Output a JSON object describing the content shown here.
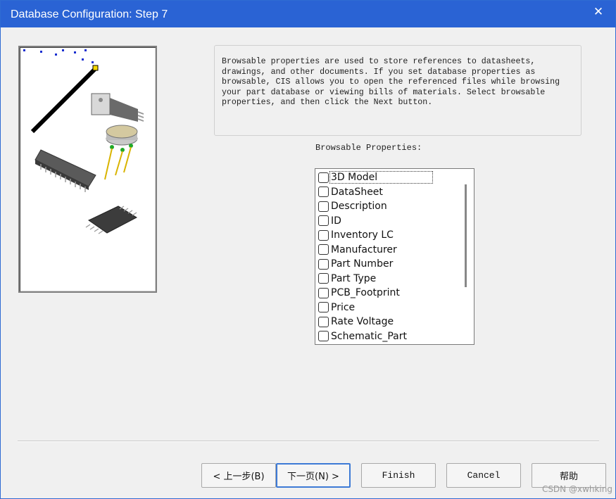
{
  "window": {
    "title": "Database Configuration: Step 7",
    "close_symbol": "✕"
  },
  "description": "Browsable properties are used to store references to datasheets, drawings, and other documents. If you set database properties as browsable, CIS allows you to open the referenced files while browsing your part database or viewing bills of materials. Select browsable properties, and then click the Next button.",
  "properties_label": "Browsable Properties:",
  "properties": [
    {
      "label": "3D Model",
      "checked": false,
      "focused": true
    },
    {
      "label": "DataSheet",
      "checked": false
    },
    {
      "label": "Description",
      "checked": false
    },
    {
      "label": "ID",
      "checked": false
    },
    {
      "label": "Inventory LC",
      "checked": false
    },
    {
      "label": "Manufacturer",
      "checked": false
    },
    {
      "label": "Part Number",
      "checked": false
    },
    {
      "label": "Part Type",
      "checked": false
    },
    {
      "label": "PCB_Footprint",
      "checked": false
    },
    {
      "label": "Price",
      "checked": false
    },
    {
      "label": "Rate Voltage",
      "checked": false
    },
    {
      "label": "Schematic_Part",
      "checked": false
    }
  ],
  "buttons": {
    "back": "< 上一步(B)",
    "next": "下一页(N) >",
    "finish": "Finish",
    "cancel": "Cancel",
    "help": "帮助"
  },
  "watermark": "CSDN @xwhking",
  "colors": {
    "titlebar": "#2a63d4",
    "focus_border": "#3d7ad6"
  },
  "icons": [
    "close-icon",
    "wizard-wand-icon",
    "chip-illustration"
  ]
}
